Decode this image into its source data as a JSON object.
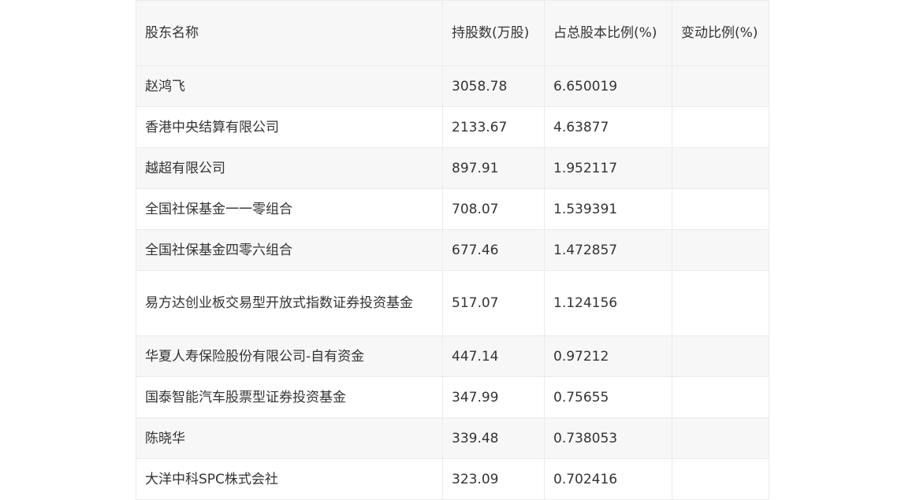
{
  "table": {
    "headers": [
      "股东名称",
      "持股数(万股)",
      "占总股本比例(%)",
      "变动比例(%)"
    ],
    "rows": [
      {
        "name": "赵鸿飞",
        "shares": "3058.78",
        "ratio": "6.650019",
        "change": ""
      },
      {
        "name": "香港中央结算有限公司",
        "shares": "2133.67",
        "ratio": "4.63877",
        "change": ""
      },
      {
        "name": "越超有限公司",
        "shares": "897.91",
        "ratio": "1.952117",
        "change": ""
      },
      {
        "name": "全国社保基金一一零组合",
        "shares": "708.07",
        "ratio": "1.539391",
        "change": ""
      },
      {
        "name": "全国社保基金四零六组合",
        "shares": "677.46",
        "ratio": "1.472857",
        "change": ""
      },
      {
        "name": "易方达创业板交易型开放式指数证券投资基金",
        "shares": "517.07",
        "ratio": "1.124156",
        "change": ""
      },
      {
        "name": "华夏人寿保险股份有限公司-自有资金",
        "shares": "447.14",
        "ratio": "0.97212",
        "change": ""
      },
      {
        "name": "国泰智能汽车股票型证券投资基金",
        "shares": "347.99",
        "ratio": "0.75655",
        "change": ""
      },
      {
        "name": "陈晓华",
        "shares": "339.48",
        "ratio": "0.738053",
        "change": ""
      },
      {
        "name": "大洋中科SPC株式会社",
        "shares": "323.09",
        "ratio": "0.702416",
        "change": ""
      }
    ]
  }
}
